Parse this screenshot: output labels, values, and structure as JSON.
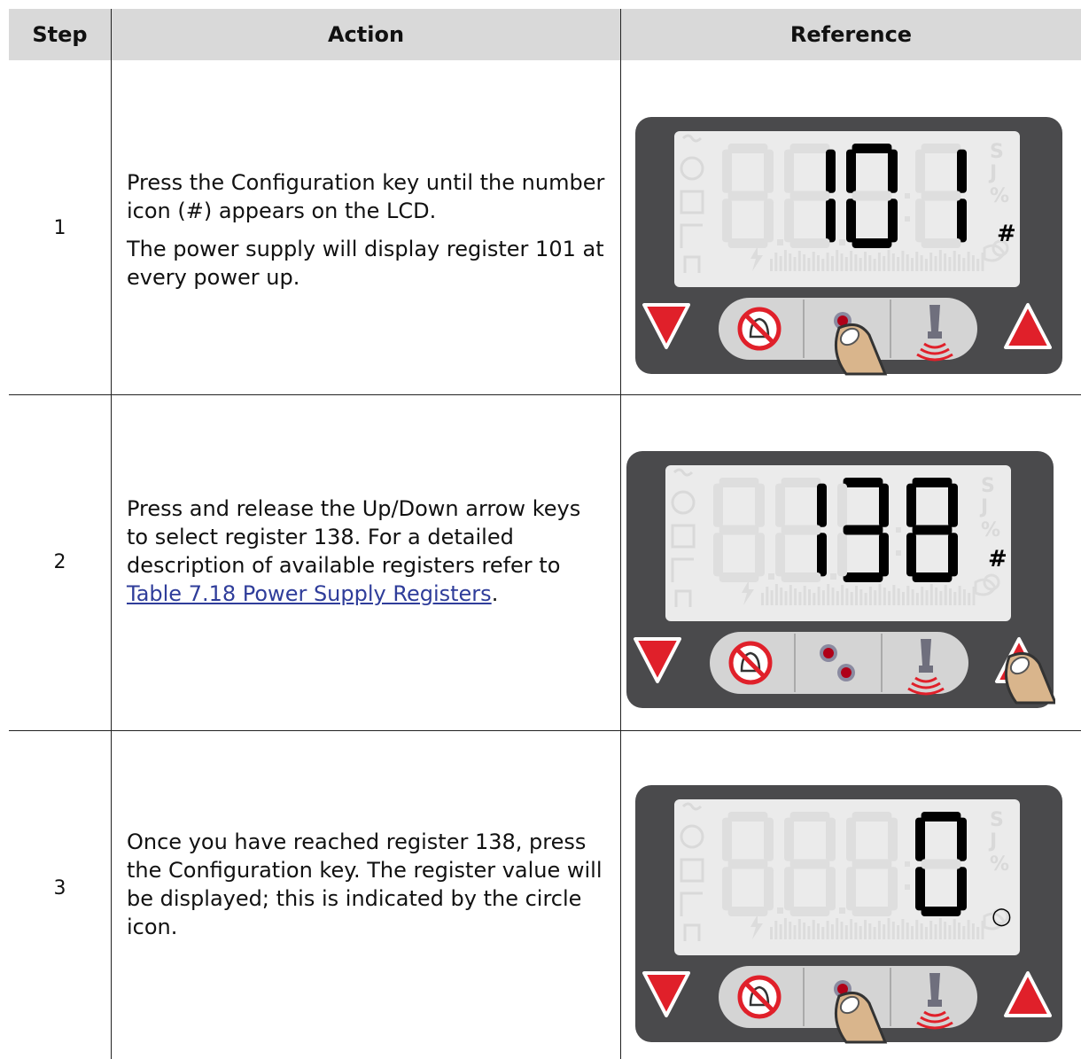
{
  "table": {
    "headers": {
      "step": "Step",
      "action": "Action",
      "reference": "Reference"
    },
    "rows": [
      {
        "step": "1",
        "paragraphs": [
          "Press the Configuration key until the number icon (#) appears on the LCD.",
          "The power supply will display register 101 at every power up."
        ],
        "display": {
          "digits": "101",
          "indicator": "#"
        }
      },
      {
        "step": "2",
        "text_before": "Press and release the Up/Down arrow keys to select register 138. For a detailed description of available registers refer to ",
        "link_text": "Table 7.18 Power Supply Registers",
        "text_after": ".",
        "display": {
          "digits": "138",
          "indicator": "#"
        }
      },
      {
        "step": "3",
        "paragraphs": [
          "Once you have reached register 138, press the Configuration key. The register value will be displayed; this is indicated by the circle icon."
        ],
        "display": {
          "digits": "0",
          "indicator": "○"
        }
      }
    ]
  },
  "lcd": {
    "ghost_icons": {
      "s": "S",
      "j": "J",
      "pct": "%",
      "hash": "#"
    }
  },
  "colors": {
    "header_bg": "#d9d9d9",
    "link": "#2f3d9a",
    "panel_body": "#4a4a4c",
    "lcd_bg": "#ebebeb",
    "segment_on": "#000000",
    "arrow_red": "#e0202a",
    "key_bg": "#d4d4d4",
    "finger": "#d9b58c"
  }
}
